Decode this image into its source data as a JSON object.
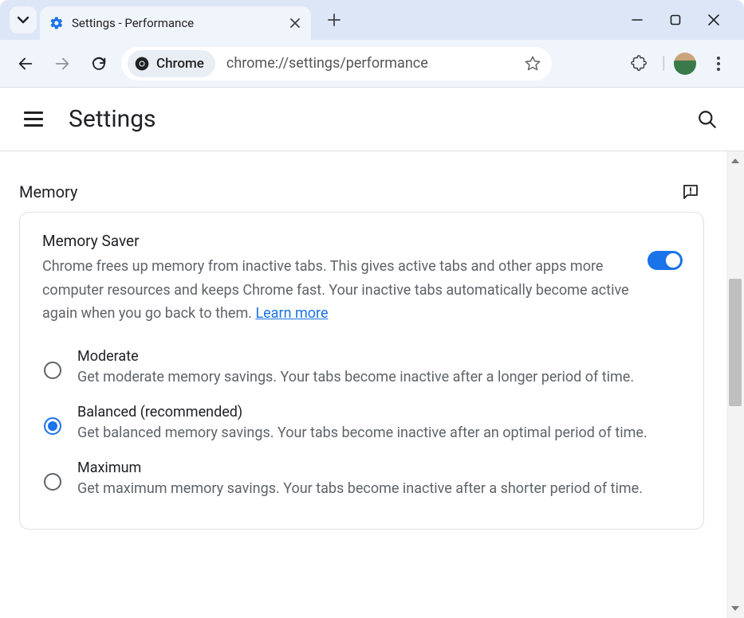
{
  "browser": {
    "tab_title": "Settings - Performance",
    "chrome_chip": "Chrome",
    "url": "chrome://settings/performance"
  },
  "header": {
    "title": "Settings"
  },
  "section": {
    "title": "Memory"
  },
  "card": {
    "title": "Memory Saver",
    "description": "Chrome frees up memory from inactive tabs. This gives active tabs and other apps more computer resources and keeps Chrome fast. Your inactive tabs automatically become active again when you go back to them. ",
    "learn_more": "Learn more",
    "toggle_on": true,
    "options": [
      {
        "id": "moderate",
        "title": "Moderate",
        "desc": "Get moderate memory savings. Your tabs become inactive after a longer period of time.",
        "selected": false
      },
      {
        "id": "balanced",
        "title": "Balanced (recommended)",
        "desc": "Get balanced memory savings. Your tabs become inactive after an optimal period of time.",
        "selected": true
      },
      {
        "id": "maximum",
        "title": "Maximum",
        "desc": "Get maximum memory savings. Your tabs become inactive after a shorter period of time.",
        "selected": false
      }
    ]
  }
}
